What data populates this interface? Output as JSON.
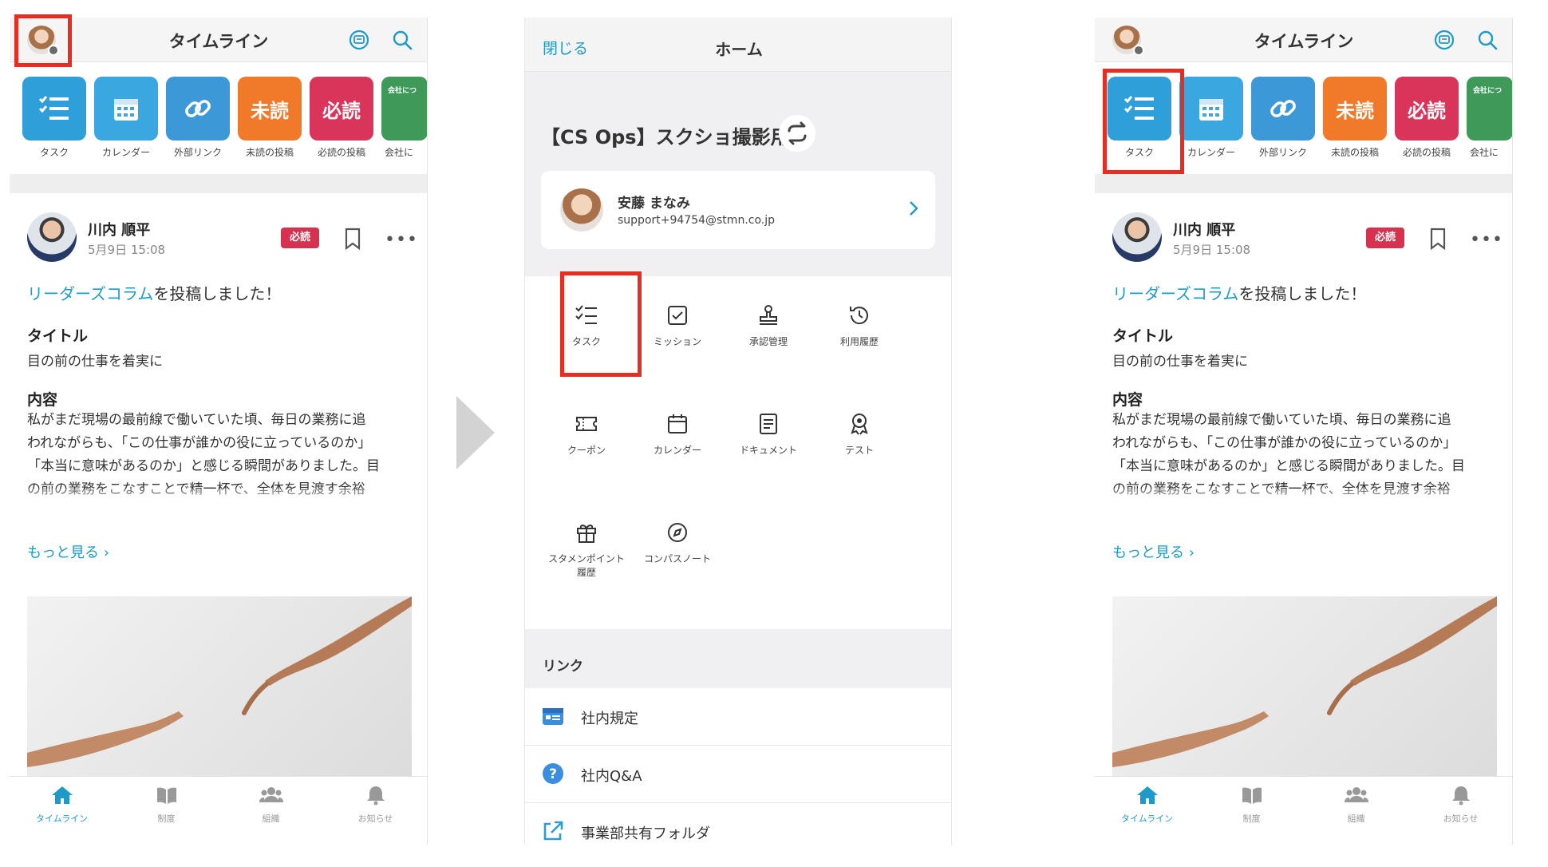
{
  "timeline": {
    "header_title": "タイムライン",
    "shortcuts": [
      {
        "label": "タスク",
        "color": "#2f9fd9",
        "icon": "task-list-icon",
        "text": ""
      },
      {
        "label": "カレンダー",
        "color": "#3aa7e0",
        "icon": "calendar-icon",
        "text": ""
      },
      {
        "label": "外部リンク",
        "color": "#3d98d8",
        "icon": "link-icon",
        "text": ""
      },
      {
        "label": "未読の投稿",
        "color": "#f07a2a",
        "icon": "unread-icon",
        "text": "未読"
      },
      {
        "label": "必読の投稿",
        "color": "#d9345a",
        "icon": "must-read-icon",
        "text": "必読"
      },
      {
        "label": "会社に",
        "color": "#3f9a5a",
        "icon": "company-icon",
        "text": "会社につ"
      }
    ],
    "post": {
      "author": "川内 順平",
      "date": "5月9日 15:08",
      "badge": "必読",
      "lead_link": "リーダーズコラム",
      "lead_rest": "を投稿しました！",
      "title_heading": "タイトル",
      "title_text": "目の前の仕事を着実に",
      "content_heading": "内容",
      "content_lines": [
        "私がまだ現場の最前線で働いていた頃、毎日の業務に追",
        "われながらも、「この仕事が誰かの役に立っているのか」",
        "「本当に意味があるのか」と感じる瞬間がありました。目",
        "の前の業務をこなすことで精一杯で、全体を見渡す余裕"
      ],
      "more_link": "もっと見る"
    },
    "tabs": [
      {
        "label": "タイムライン",
        "icon": "home-icon"
      },
      {
        "label": "制度",
        "icon": "book-icon"
      },
      {
        "label": "組織",
        "icon": "people-icon"
      },
      {
        "label": "お知らせ",
        "icon": "bell-icon"
      }
    ]
  },
  "home": {
    "close_label": "閉じる",
    "title": "ホーム",
    "workspace": "【CS Ops】スクショ撮影用",
    "profile": {
      "name": "安藤 まなみ",
      "email": "support+94754@stmn.co.jp"
    },
    "menu": [
      {
        "label": "タスク",
        "icon": "task-list-icon"
      },
      {
        "label": "ミッション",
        "icon": "checkbox-icon"
      },
      {
        "label": "承認管理",
        "icon": "stamp-icon"
      },
      {
        "label": "利用履歴",
        "icon": "history-icon"
      },
      {
        "label": "クーポン",
        "icon": "coupon-icon"
      },
      {
        "label": "カレンダー",
        "icon": "calendar-icon"
      },
      {
        "label": "ドキュメント",
        "icon": "document-icon"
      },
      {
        "label": "テスト",
        "icon": "award-icon"
      },
      {
        "label": "スタメンポイント履歴",
        "icon": "gift-icon"
      },
      {
        "label": "コンパスノート",
        "icon": "compass-icon"
      }
    ],
    "links_heading": "リンク",
    "links": [
      {
        "label": "社内規定",
        "icon": "card-icon"
      },
      {
        "label": "社内Q&A",
        "icon": "question-icon"
      },
      {
        "label": "事業部共有フォルダ",
        "icon": "external-link-icon"
      }
    ]
  },
  "colors": {
    "accent": "#1e9ac8",
    "highlight": "#e52d24",
    "must_read": "#d6314f"
  }
}
